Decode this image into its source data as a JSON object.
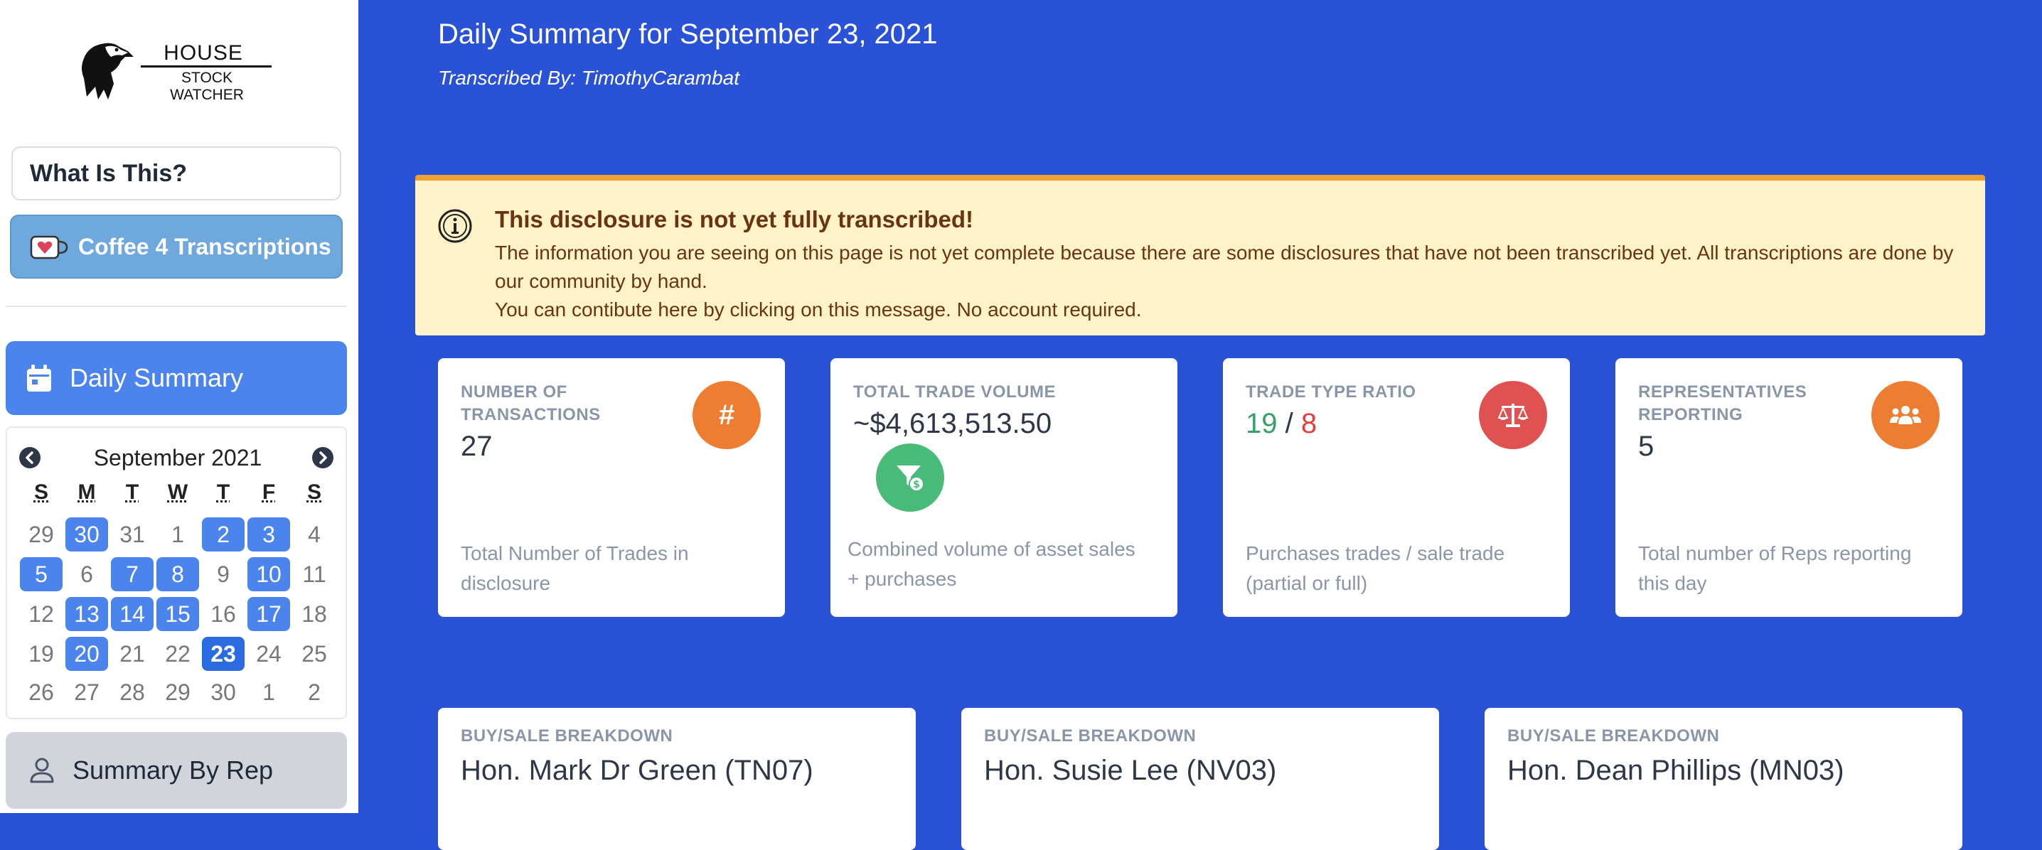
{
  "sidebar": {
    "logo": {
      "top": "HOUSE",
      "bottom": "STOCK WATCHER"
    },
    "what_label": "What Is This?",
    "coffee_label": "Coffee 4 Transcriptions",
    "daily_label": "Daily Summary",
    "rep_label": "Summary By Rep",
    "calendar": {
      "month": "September 2021",
      "dow": [
        "S",
        "M",
        "T",
        "W",
        "T",
        "F",
        "S"
      ],
      "weeks": [
        [
          {
            "d": "29",
            "s": "muted"
          },
          {
            "d": "30",
            "s": "has"
          },
          {
            "d": "31",
            "s": "muted"
          },
          {
            "d": "1",
            "s": "muted"
          },
          {
            "d": "2",
            "s": "has"
          },
          {
            "d": "3",
            "s": "has"
          },
          {
            "d": "4",
            "s": "muted"
          }
        ],
        [
          {
            "d": "5",
            "s": "has"
          },
          {
            "d": "6",
            "s": "muted"
          },
          {
            "d": "7",
            "s": "has"
          },
          {
            "d": "8",
            "s": "has"
          },
          {
            "d": "9",
            "s": "muted"
          },
          {
            "d": "10",
            "s": "has"
          },
          {
            "d": "11",
            "s": "muted"
          }
        ],
        [
          {
            "d": "12",
            "s": "muted"
          },
          {
            "d": "13",
            "s": "has"
          },
          {
            "d": "14",
            "s": "has"
          },
          {
            "d": "15",
            "s": "has"
          },
          {
            "d": "16",
            "s": "muted"
          },
          {
            "d": "17",
            "s": "has"
          },
          {
            "d": "18",
            "s": "muted"
          }
        ],
        [
          {
            "d": "19",
            "s": "muted"
          },
          {
            "d": "20",
            "s": "has"
          },
          {
            "d": "21",
            "s": "muted"
          },
          {
            "d": "22",
            "s": "muted"
          },
          {
            "d": "23",
            "s": "sel"
          },
          {
            "d": "24",
            "s": "muted"
          },
          {
            "d": "25",
            "s": "muted"
          }
        ],
        [
          {
            "d": "26",
            "s": "muted"
          },
          {
            "d": "27",
            "s": "muted"
          },
          {
            "d": "28",
            "s": "muted"
          },
          {
            "d": "29",
            "s": "muted"
          },
          {
            "d": "30",
            "s": "muted"
          },
          {
            "d": "1",
            "s": "muted"
          },
          {
            "d": "2",
            "s": "muted"
          }
        ]
      ]
    }
  },
  "main": {
    "title": "Daily Summary for September 23, 2021",
    "subtitle": "Transcribed By: TimothyCarambat"
  },
  "alert": {
    "title": "This disclosure is not yet fully transcribed!",
    "line1": "The information you are seeing on this page is not yet complete because there are some disclosures that have not been transcribed yet. All transcriptions are done by our community by hand.",
    "line2": "You can contibute here by clicking on this message. No account required."
  },
  "stats": {
    "transactions": {
      "label": "NUMBER OF TRANSACTIONS",
      "value": "27",
      "foot": "Total Number of Trades in disclosure",
      "symbol": "#"
    },
    "volume": {
      "label": "TOTAL TRADE VOLUME",
      "value": "~$4,613,513.50",
      "foot": "Combined volume of asset sales + purchases"
    },
    "ratio": {
      "label": "TRADE TYPE RATIO",
      "buy": "19",
      "sep": "/",
      "sell": "8",
      "foot": "Purchases trades / sale trade (partial or full)"
    },
    "reps": {
      "label": "REPRESENTATIVES REPORTING",
      "value": "5",
      "foot": "Total number of Reps reporting this day"
    }
  },
  "breakdowns": [
    {
      "label": "BUY/SALE BREAKDOWN",
      "name": "Hon. Mark Dr Green (TN07)"
    },
    {
      "label": "BUY/SALE BREAKDOWN",
      "name": "Hon. Susie Lee (NV03)"
    },
    {
      "label": "BUY/SALE BREAKDOWN",
      "name": "Hon. Dean Phillips (MN03)"
    }
  ],
  "colors": {
    "background": "#2a52d6",
    "accent": "#4a84ec",
    "orange": "#ed7d31",
    "green": "#48bb78",
    "red": "#e05252"
  },
  "icons": [
    "eagle-logo-icon",
    "coffee-cup-icon",
    "calendar-icon",
    "chevron-left-icon",
    "chevron-right-icon",
    "user-icon",
    "info-icon",
    "hash-icon",
    "funnel-dollar-icon",
    "balance-scale-icon",
    "users-icon"
  ]
}
